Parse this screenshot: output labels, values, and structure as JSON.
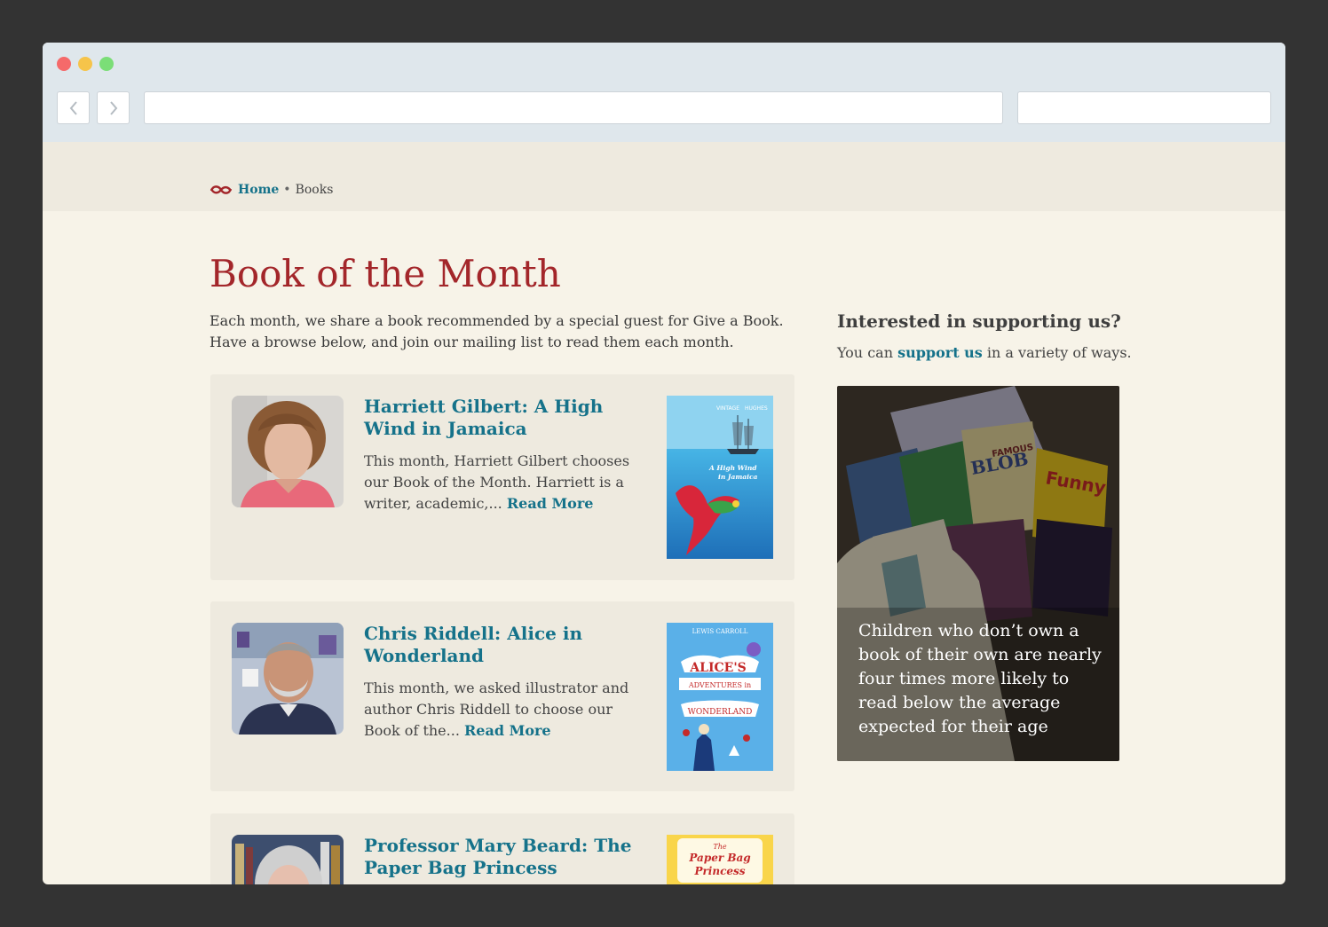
{
  "breadcrumb": {
    "home": "Home",
    "separator": "•",
    "current": "Books"
  },
  "page": {
    "title": "Book of the Month",
    "intro": "Each month, we share a book recommended by a special guest for Give a Book. Have a browse below, and join our mailing list to read them each month."
  },
  "books": [
    {
      "title": "Harriett Gilbert: A High Wind in Jamaica",
      "excerpt": "This month, Harriett Gilbert chooses our Book of the Month. Harriett is a writer, academic,...",
      "read_more": "Read More",
      "cover_publisher": "VINTAGE",
      "cover_author": "HUGHES",
      "cover_title_line1": "A High Wind",
      "cover_title_line2": "in Jamaica"
    },
    {
      "title": "Chris Riddell: Alice in Wonderland",
      "excerpt": "This month, we asked illustrator and author Chris Riddell to choose our Book of the...",
      "read_more": "Read More",
      "cover_author": "LEWIS CARROLL",
      "cover_title_line1": "ALICE'S",
      "cover_title_line2": "ADVENTURES in",
      "cover_title_line3": "WONDERLAND"
    },
    {
      "title": "Professor Mary Beard: The Paper Bag Princess",
      "cover_title_line1": "The",
      "cover_title_line2": "Paper Bag",
      "cover_title_line3": "Princess"
    }
  ],
  "sidebar": {
    "title": "Interested in supporting us?",
    "text_before": "You can ",
    "link": "support us",
    "text_after": " in a variety of ways.",
    "promo_text": "Children who don’t own a book of their own are nearly four times more likely to read below the average expected for their age",
    "promo_labels": {
      "funny": "Funny",
      "blob": "BLOB",
      "famous": "FAMOUS"
    }
  },
  "colors": {
    "accent_red": "#a3262a",
    "link_teal": "#15728a",
    "page_bg": "#f7f3e8",
    "card_bg": "#eeeadf"
  }
}
